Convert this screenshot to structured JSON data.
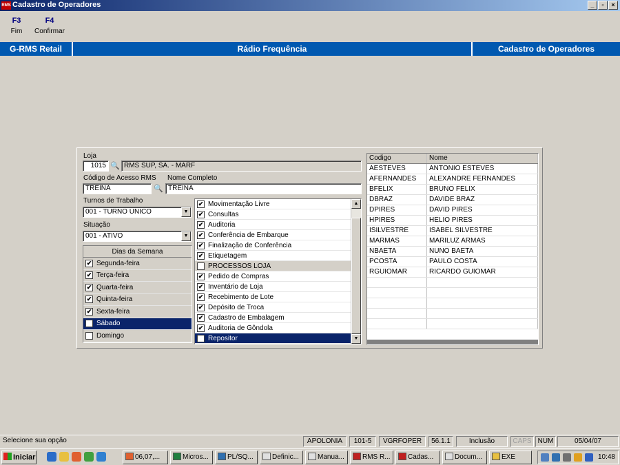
{
  "window": {
    "title": "Cadastro de Operadores",
    "icon_text": "RMS",
    "buttons": [
      "_",
      "▫",
      "×"
    ]
  },
  "fkeys": [
    {
      "key": "F3",
      "label": "Fim"
    },
    {
      "key": "F4",
      "label": "Confirmar"
    }
  ],
  "header": {
    "left": "G-RMS Retail",
    "center": "Rádio Frequência",
    "right": "Cadastro de Operadores"
  },
  "form": {
    "loja_label": "Loja",
    "loja_code": "1015",
    "loja_name": "RMS SUP, SA. - MARF",
    "codigo_label": "Código de Acesso RMS",
    "codigo_value": "TREINA",
    "nome_label": "Nome Completo",
    "nome_value": "TREINA",
    "turnos_label": "Turnos de Trabalho",
    "turnos_value": "001 - TURNO UNICO",
    "situacao_label": "Situação",
    "situacao_value": "001 - ATIVO"
  },
  "dias": {
    "header": "Dias da Semana",
    "items": [
      {
        "label": "Segunda-feira",
        "checked": true,
        "selected": false
      },
      {
        "label": "Terça-feira",
        "checked": true,
        "selected": false
      },
      {
        "label": "Quarta-feira",
        "checked": true,
        "selected": false
      },
      {
        "label": "Quinta-feira",
        "checked": true,
        "selected": false
      },
      {
        "label": "Sexta-feira",
        "checked": true,
        "selected": false
      },
      {
        "label": "Sábado",
        "checked": true,
        "selected": true
      },
      {
        "label": "Domingo",
        "checked": false,
        "selected": false
      }
    ]
  },
  "funcoes": [
    {
      "label": "Movimentação Livre",
      "checked": true,
      "state": ""
    },
    {
      "label": "Consultas",
      "checked": true,
      "state": ""
    },
    {
      "label": "Auditoria",
      "checked": true,
      "state": ""
    },
    {
      "label": "Conferência de Embarque",
      "checked": true,
      "state": ""
    },
    {
      "label": "Finalização de Conferência",
      "checked": true,
      "state": ""
    },
    {
      "label": "Etiquetagem",
      "checked": true,
      "state": ""
    },
    {
      "label": "PROCESSOS LOJA",
      "checked": false,
      "state": "gray"
    },
    {
      "label": "Pedido de Compras",
      "checked": true,
      "state": ""
    },
    {
      "label": "Inventário de Loja",
      "checked": true,
      "state": ""
    },
    {
      "label": "Recebimento de Lote",
      "checked": true,
      "state": ""
    },
    {
      "label": "Depósito de Troca",
      "checked": true,
      "state": ""
    },
    {
      "label": "Cadastro de Embalagem",
      "checked": true,
      "state": ""
    },
    {
      "label": "Auditoria de Gôndola",
      "checked": true,
      "state": ""
    },
    {
      "label": "Repositor",
      "checked": true,
      "state": "sel"
    }
  ],
  "grid": {
    "columns": [
      "Codigo",
      "Nome"
    ],
    "rows": [
      [
        "AESTEVES",
        "ANTONIO ESTEVES"
      ],
      [
        "AFERNANDES",
        "ALEXANDRE FERNANDES"
      ],
      [
        "BFELIX",
        "BRUNO FELIX"
      ],
      [
        "DBRAZ",
        "DAVIDE BRAZ"
      ],
      [
        "DPIRES",
        "DAVID PIRES"
      ],
      [
        "HPIRES",
        "HELIO PIRES"
      ],
      [
        "ISILVESTRE",
        "ISABEL SILVESTRE"
      ],
      [
        "MARMAS",
        "MARILUZ ARMAS"
      ],
      [
        "NBAETA",
        "NUNO BAETA"
      ],
      [
        "PCOSTA",
        "PAULO COSTA"
      ],
      [
        "RGUIOMAR",
        "RICARDO GUIOMAR"
      ],
      [
        "",
        ""
      ],
      [
        "",
        ""
      ],
      [
        "",
        ""
      ],
      [
        "",
        ""
      ],
      [
        "",
        ""
      ]
    ]
  },
  "status": {
    "message": "Selecione sua opção",
    "fields": [
      "APOLONIA",
      "101-5",
      "VGRFOPER",
      "56.1.1",
      "Inclusão",
      "CAPS",
      "NUM",
      "05/04/07"
    ]
  },
  "taskbar": {
    "start": "Iniciar",
    "tasks": [
      "06,07,...",
      "Micros...",
      "PL/SQ...",
      "Definic...",
      "Manua...",
      "RMS R...",
      "Cadas...",
      "Docum...",
      "EXE"
    ],
    "clock": "10:48",
    "colors": {
      "accent": "#0a246a",
      "header": "#0058b0",
      "face": "#d4d0c8"
    }
  }
}
